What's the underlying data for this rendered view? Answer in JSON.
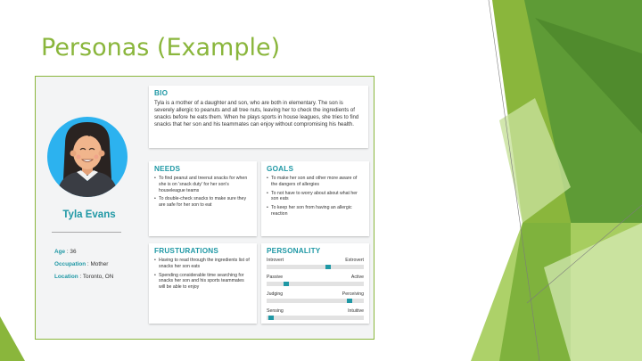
{
  "slide": {
    "title": "Personas (Example)"
  },
  "colors": {
    "accent": "#1f98a5",
    "title_green": "#8ab63c",
    "card_border": "#8ab63c"
  },
  "persona": {
    "name": "Tyla Evans",
    "facts": [
      {
        "label": "Age",
        "value": " : 36"
      },
      {
        "label": "Occupation",
        "value": " : Mother"
      },
      {
        "label": "Location",
        "value": " : Toronto, ON"
      }
    ],
    "bio": {
      "title": "BIO",
      "text": "Tyla is a mother of a daughter and son, who are both in elementary.  The son is severely allergic to peanuts and all tree nuts, leaving her to check the ingredients of snacks before he eats them.  When he plays sports in house leagues, she tries to find snacks that her son and his teammates can enjoy without compromising his health."
    },
    "needs": {
      "title": "NEEDS",
      "items": [
        "To find peanut and treenut snacks for when she is on 'snack duty' for her son's houseleague teams",
        "To double-check snacks to make sure they are safe for her son to eat"
      ]
    },
    "goals": {
      "title": "GOALS",
      "items": [
        "To make her son and other more aware of the dangers of allergies",
        "To not have to worry about about what her son eats",
        "To keep her son from having an allergic reaction"
      ]
    },
    "frustrations": {
      "title": "FRUSTURATIONS",
      "items": [
        "Having to read through the ingredients list of snacks her son eats",
        "Spending considerable time searching for snacks her son and his sports teammates will be able to enjoy"
      ]
    },
    "personality": {
      "title": "PERSONALITY",
      "traits": [
        {
          "left": "Introvert",
          "right": "Extrovert",
          "value": 0.64
        },
        {
          "left": "Passive",
          "right": "Active",
          "value": 0.18
        },
        {
          "left": "Judging",
          "right": "Perceiving",
          "value": 0.87
        },
        {
          "left": "Sensing",
          "right": "Intuitive",
          "value": 0.02
        }
      ]
    }
  }
}
